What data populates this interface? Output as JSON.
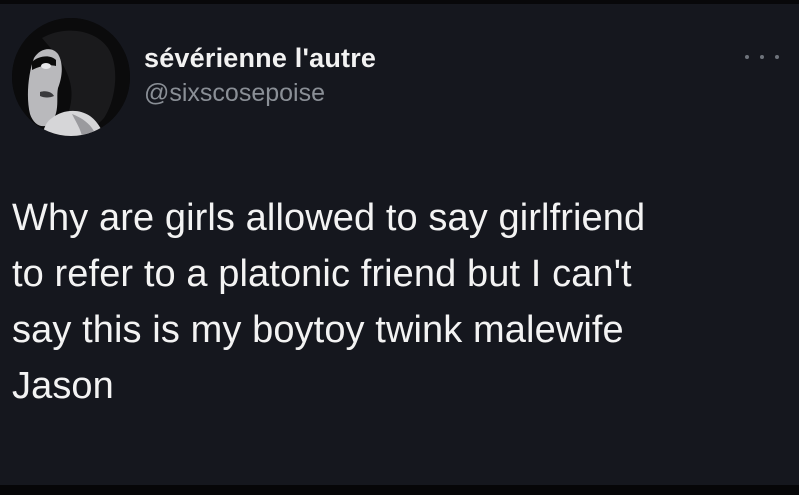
{
  "user": {
    "display_name": "sévérienne l'autre",
    "handle": "@sixscosepoise",
    "avatar_icon": "avatar-image"
  },
  "menu": {
    "icon": "more-options-icon"
  },
  "tweet": {
    "text": "Why are girls allowed to say girlfriend\nto refer to a platonic friend but I can't\nsay this is my boytoy twink malewife\nJason"
  },
  "colors": {
    "background": "#15171e",
    "primary_text": "#f2f2f2",
    "secondary_text": "#8a8f96"
  }
}
